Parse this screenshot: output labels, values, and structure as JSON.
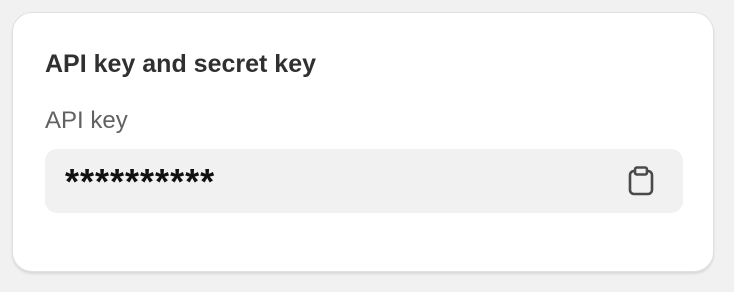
{
  "card": {
    "title": "API key and secret key",
    "api_key": {
      "label": "API key",
      "value": "**********",
      "copy_icon": "clipboard-icon"
    }
  },
  "colors": {
    "card_background": "#ffffff",
    "page_background": "#f1f1f1",
    "field_background": "#f1f1f1",
    "title_text": "#303030",
    "label_text": "#616161",
    "value_text": "#111111",
    "icon_color": "#4a4a4a"
  }
}
